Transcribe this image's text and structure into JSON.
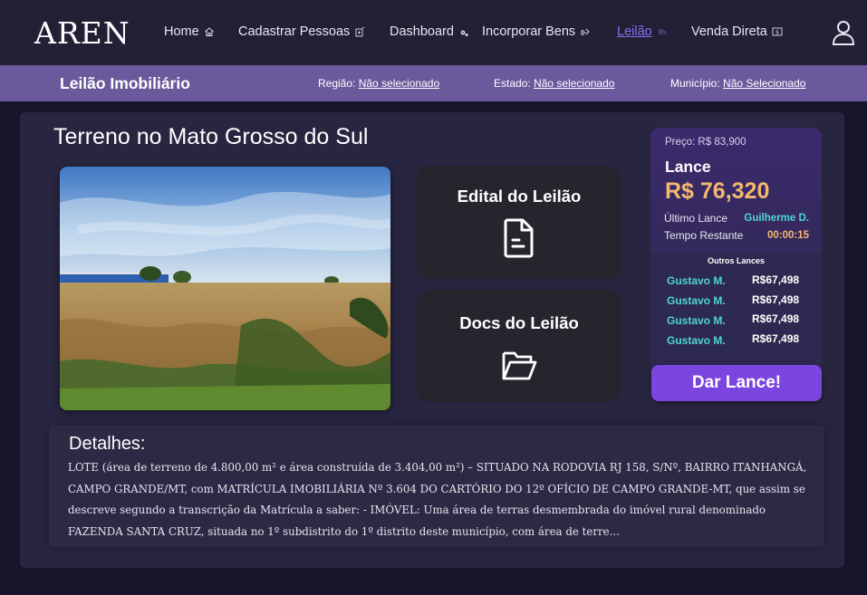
{
  "nav": {
    "logo": "AREN",
    "items": [
      {
        "label": "Home",
        "icon": "home-icon"
      },
      {
        "label": "Cadastrar Pessoas",
        "icon": "person-add-icon"
      },
      {
        "label": "Dashboard",
        "icon": "gears-icon"
      },
      {
        "label": "Incorporar Bens",
        "icon": "hand-coin-icon"
      },
      {
        "label": "Leilão",
        "icon": "gavel-icon",
        "active": true
      },
      {
        "label": "Venda Direta",
        "icon": "dollar-box-icon"
      }
    ],
    "user_icon": "user-icon"
  },
  "subnav": {
    "title": "Leilão Imobiliário",
    "filters": [
      {
        "label": "Região:",
        "value": "Não selecionado"
      },
      {
        "label": "Estado:",
        "value": "Não selecionado"
      },
      {
        "label": "Município:",
        "value": "Não Selecionado"
      }
    ]
  },
  "property": {
    "title": "Terreno no Mato Grosso do Sul"
  },
  "docs": [
    {
      "label": "Edital do Leilão",
      "icon": "document-icon"
    },
    {
      "label": "Docs do Leilão",
      "icon": "folder-icon"
    }
  ],
  "bid": {
    "price": "Preço: R$ 83,900",
    "lance_label": "Lance",
    "amount": "R$ 76,320",
    "last_bid_label": "Último Lance",
    "last_bidder": "Guilherme D.",
    "time_label": "Tempo Restante",
    "time_value": "00:00:15",
    "others_label": "Outros Lances",
    "others": [
      {
        "name": "Gustavo M.",
        "value": "R$67,498"
      },
      {
        "name": "Gustavo M.",
        "value": "R$67,498"
      },
      {
        "name": "Gustavo M.",
        "value": "R$67,498"
      },
      {
        "name": "Gustavo M.",
        "value": "R$67,498"
      }
    ],
    "button": "Dar Lance!"
  },
  "details": {
    "title": "Detalhes:",
    "text": "LOTE (área de terreno de 4.800,00 m² e área construída de 3.404,00 m²) – SITUADO NA RODOVIA RJ 158, S/Nº, BAIRRO ITANHANGÁ, CAMPO GRANDE/MT, com MATRÍCULA IMOBILIÁRIA Nº 3.604 DO CARTÓRIO DO 12º OFÍCIO DE CAMPO GRANDE-MT, que assim se descreve segundo a transcrição da Matrícula a saber: - IMÓVEL: Uma área de terras desmembrada do imóvel rural denominado FAZENDA SANTA CRUZ, situada no 1º subdistrito do 1º distrito deste município, com área de terre..."
  },
  "colors": {
    "accent": "#7b45e0",
    "bid_amount": "#f4b870",
    "bidder": "#4fd6d0",
    "active_nav": "#8b6cf0"
  }
}
